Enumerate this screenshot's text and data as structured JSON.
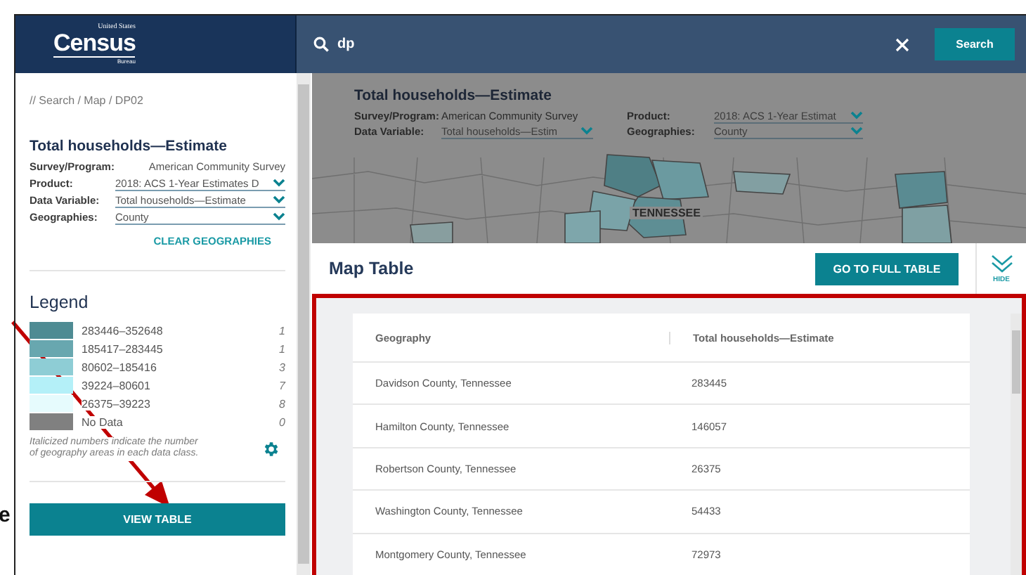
{
  "annotation": {
    "text": "e"
  },
  "header": {
    "logo": {
      "top": "United States",
      "main": "Census",
      "bottom": "Bureau"
    },
    "search": {
      "value": "dp",
      "button": "Search"
    }
  },
  "sidebar": {
    "breadcrumb": "// Search / Map / DP02",
    "title": "Total households—Estimate",
    "fields": [
      {
        "label": "Survey/Program:",
        "value": "American Community Survey",
        "kind": "text"
      },
      {
        "label": "Product:",
        "value": "2018: ACS 1-Year Estimates D",
        "kind": "dropdown"
      },
      {
        "label": "Data Variable:",
        "value": "Total households—Estimate",
        "kind": "dropdown"
      },
      {
        "label": "Geographies:",
        "value": "County",
        "kind": "dropdown"
      }
    ],
    "clear_button": "CLEAR GEOGRAPHIES",
    "legend": {
      "title": "Legend",
      "classes": [
        {
          "range": "283446–352648",
          "count": "1",
          "color": "#4e8b93"
        },
        {
          "range": "185417–283445",
          "count": "1",
          "color": "#68a7af"
        },
        {
          "range": "80602–185416",
          "count": "3",
          "color": "#8ecdd5"
        },
        {
          "range": "39224–80601",
          "count": "7",
          "color": "#b4f0f8"
        },
        {
          "range": "26375–39223",
          "count": "8",
          "color": "#e6fbfd"
        },
        {
          "range": "No Data",
          "count": "0",
          "color": "#808080"
        }
      ],
      "note": "Italicized numbers indicate the number of geography areas in each data class."
    },
    "view_button": "VIEW TABLE"
  },
  "map": {
    "title": "Total households—Estimate",
    "fields": [
      {
        "label": "Survey/Program:",
        "value": "American Community Survey",
        "kind": "text"
      },
      {
        "label": "Product:",
        "value": "2018: ACS 1-Year Estimat",
        "kind": "dropdown"
      },
      {
        "label": "Data Variable:",
        "value": "Total households—Estim",
        "kind": "dropdown"
      },
      {
        "label": "Geographies:",
        "value": "County",
        "kind": "dropdown"
      }
    ],
    "label": "TENNESSEE"
  },
  "map_table": {
    "title": "Map Table",
    "full_table_button": "GO TO FULL TABLE",
    "hide_label": "HIDE",
    "columns": [
      "Geography",
      "Total households—Estimate"
    ],
    "rows": [
      [
        "Davidson County, Tennessee",
        "283445"
      ],
      [
        "Hamilton County, Tennessee",
        "146057"
      ],
      [
        "Robertson County, Tennessee",
        "26375"
      ],
      [
        "Washington County, Tennessee",
        "54433"
      ],
      [
        "Montgomery County, Tennessee",
        "72973"
      ]
    ]
  }
}
